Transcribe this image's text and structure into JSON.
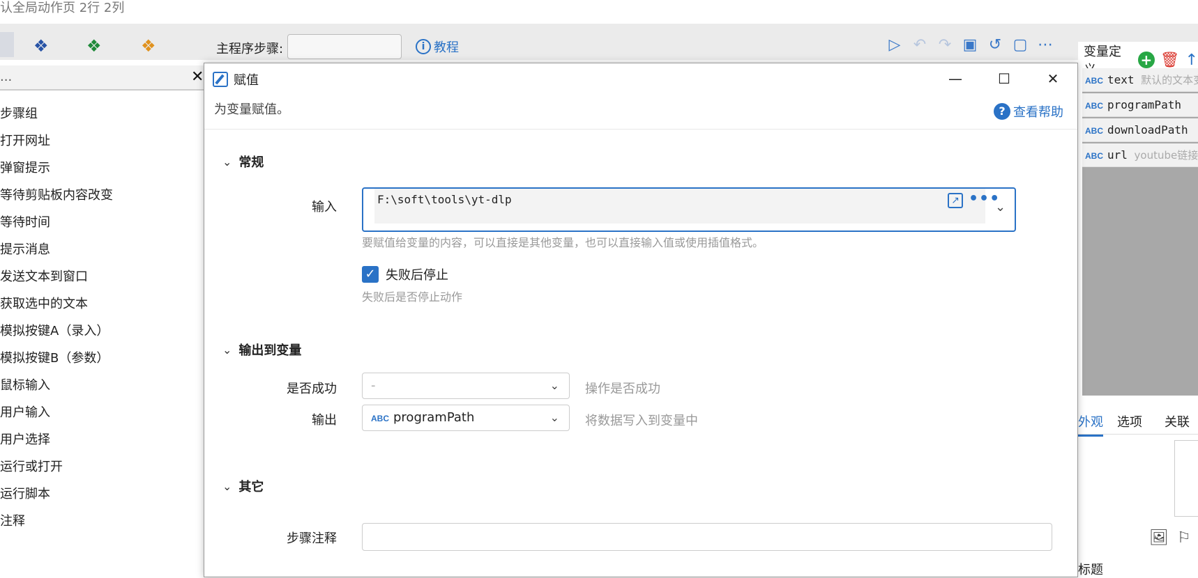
{
  "window": {
    "title": "认全局动作页 2行 2列"
  },
  "toolbar": {
    "main_steps_label": "主程序步骤:",
    "tutorial_label": "教程",
    "icons": [
      "play-icon",
      "undo-icon",
      "redo-icon",
      "save-icon",
      "history-icon",
      "note-icon",
      "more-icon"
    ]
  },
  "left": {
    "search_placeholder": "...",
    "close": "✕",
    "items": [
      "步骤组",
      "打开网址",
      "弹窗提示",
      "等待剪贴板内容改变",
      "等待时间",
      "提示消息",
      "发送文本到窗口",
      "获取选中的文本",
      "模拟按键A（录入）",
      "模拟按键B（参数）",
      "鼠标输入",
      "用户输入",
      "用户选择",
      "运行或打开",
      "运行脚本",
      "注释"
    ]
  },
  "right": {
    "title": "变量定义",
    "vars": [
      {
        "type": "ABC",
        "name": "text",
        "desc": "默认的文本变"
      },
      {
        "type": "ABC",
        "name": "programPath",
        "desc": ""
      },
      {
        "type": "ABC",
        "name": "downloadPath",
        "desc": ""
      },
      {
        "type": "ABC",
        "name": "url",
        "desc": "youtube链接"
      }
    ],
    "tabs": [
      "外观",
      "选项",
      "关联"
    ],
    "bottom_title": "标题"
  },
  "dialog": {
    "title": "赋值",
    "subtitle": "为变量赋值。",
    "help": "查看帮助",
    "sections": {
      "general": "常规",
      "output": "输出到变量",
      "other": "其它"
    },
    "input_label": "输入",
    "input_value": "F:\\soft\\tools\\yt-dlp",
    "input_hint": "要赋值给变量的内容，可以直接是其他变量，也可以直接输入值或使用插值格式。",
    "stop_on_fail_label": "失败后停止",
    "stop_on_fail_checked": true,
    "stop_on_fail_hint": "失败后是否停止动作",
    "success_label": "是否成功",
    "success_value": "-",
    "success_hint": "操作是否成功",
    "output_label": "输出",
    "output_type": "ABC",
    "output_value": "programPath",
    "output_hint": "将数据写入到变量中",
    "note_label": "步骤注释"
  }
}
